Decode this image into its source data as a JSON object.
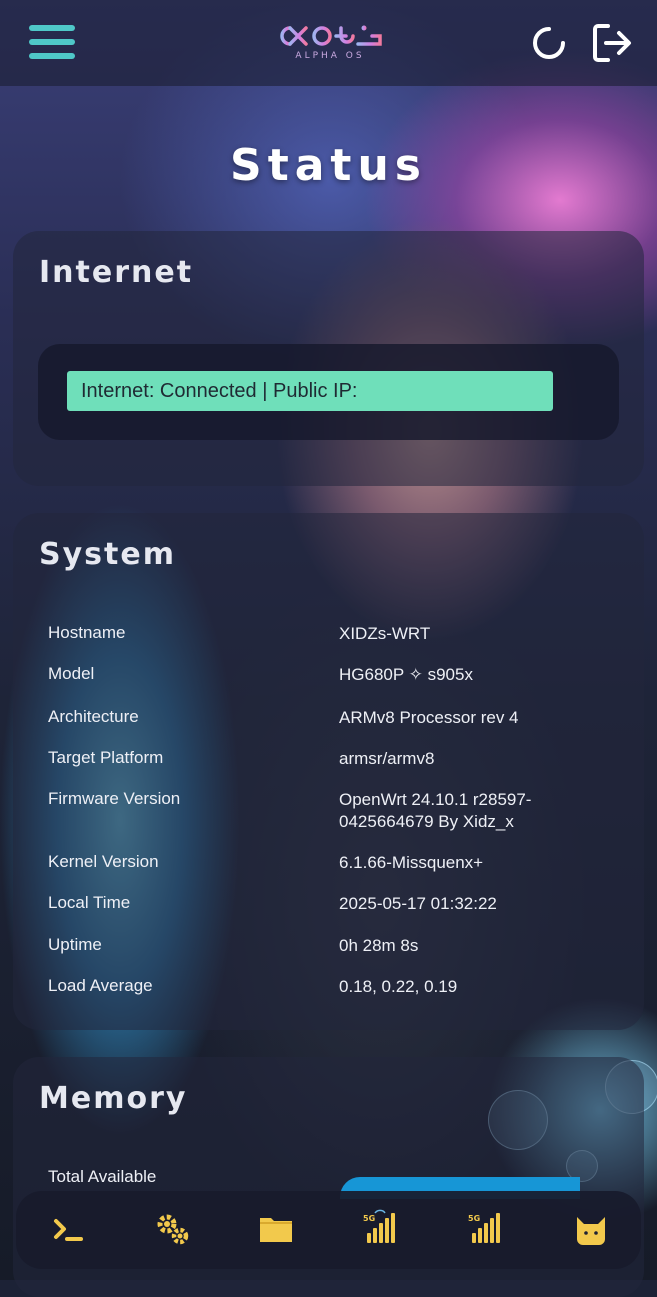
{
  "header": {
    "logo_text": "ALPHA OS",
    "menu_icon": "hamburger-menu-icon",
    "refresh_icon": "refresh-icon",
    "logout_icon": "logout-icon"
  },
  "page": {
    "title": "Status"
  },
  "internet": {
    "title": "Internet",
    "status": "Internet: Connected | Public IP:"
  },
  "system": {
    "title": "System",
    "rows": [
      {
        "label": "Hostname",
        "value": "XIDZs-WRT"
      },
      {
        "label": "Model",
        "value": "HG680P ✧ s905x"
      },
      {
        "label": "Architecture",
        "value": "ARMv8 Processor rev 4"
      },
      {
        "label": "Target Platform",
        "value": "armsr/armv8"
      },
      {
        "label": "Firmware Version",
        "value": "OpenWrt 24.10.1 r28597-0425664679 By Xidz_x"
      },
      {
        "label": "Kernel Version",
        "value": "6.1.66-Missquenx+"
      },
      {
        "label": "Local Time",
        "value": "2025-05-17 01:32:22"
      },
      {
        "label": "Uptime",
        "value": "0h 28m 8s"
      },
      {
        "label": "Load Average",
        "value": "0.18, 0.22, 0.19"
      }
    ]
  },
  "memory": {
    "title": "Memory",
    "rows": [
      {
        "label": "Total Available"
      }
    ]
  },
  "bottom_nav": [
    {
      "icon": "terminal-icon"
    },
    {
      "icon": "gears-icon"
    },
    {
      "icon": "folder-icon"
    },
    {
      "icon": "signal-5g-modem-icon"
    },
    {
      "icon": "signal-5g-icon"
    },
    {
      "icon": "cat-icon"
    }
  ],
  "colors": {
    "accent": "#4fc8c8",
    "status_ok": "#6fdfba",
    "nav_icon": "#f2c94c",
    "memory_bar": "#1796d6"
  }
}
